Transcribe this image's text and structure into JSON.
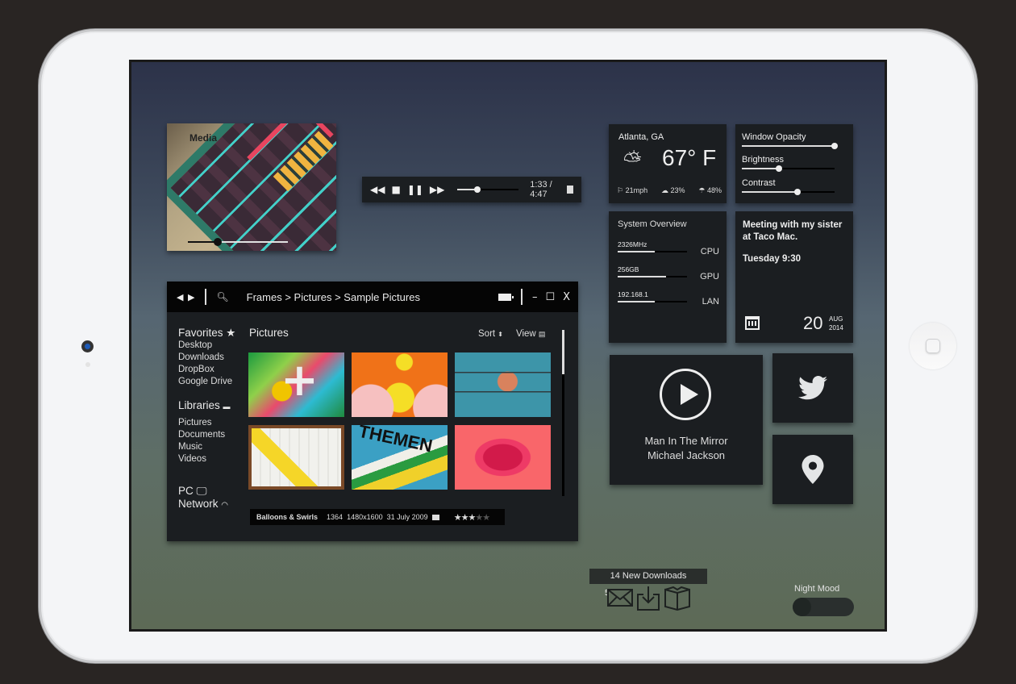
{
  "media": {
    "title": "Media",
    "progress": 0.3
  },
  "player": {
    "rewind_icon": "rewind-icon",
    "stop_icon": "stop-icon",
    "pause_icon": "pause-icon",
    "forward_icon": "fast-forward-icon",
    "time": "1:33 / 4:47",
    "progress": 0.33,
    "volume_icon": "volume-icon"
  },
  "explorer": {
    "breadcrumb": "Frames > Pictures > Sample Pictures",
    "window_controls": {
      "minimize": "–",
      "maximize": "☐",
      "close": "X"
    },
    "sidebar": {
      "favorites": {
        "label": "Favorites",
        "items": [
          "Desktop",
          "Downloads",
          "DropBox",
          "Google Drive"
        ]
      },
      "libraries": {
        "label": "Libraries",
        "items": [
          "Pictures",
          "Documents",
          "Music",
          "Videos"
        ]
      },
      "pc": "PC",
      "network": "Network"
    },
    "content_title": "Pictures",
    "sort_label": "Sort",
    "view_label": "View",
    "thumbnails": [
      "Green abstract",
      "Yellow birds",
      "City map",
      "Poster",
      "Themen print",
      "Pink knot"
    ],
    "selected": {
      "name": "Balloons & Swirls",
      "id": "1364",
      "dimensions": "1480x1600",
      "date": "31 July 2009",
      "rating": 3,
      "rating_max": 5
    }
  },
  "weather": {
    "city": "Atlanta, GA",
    "temperature": "67° F",
    "condition_icon": "partly-cloudy-icon",
    "wind": "21mph",
    "cloud": "23%",
    "rain": "48%"
  },
  "display_settings": [
    {
      "label": "Window Opacity",
      "value": 1.0
    },
    {
      "label": "Brightness",
      "value": 0.4
    },
    {
      "label": "Contrast",
      "value": 0.6
    }
  ],
  "system": {
    "title": "System Overview",
    "rows": [
      {
        "value": "2326MHz",
        "name": "CPU",
        "level": 0.53
      },
      {
        "value": "256GB",
        "name": "GPU",
        "level": 0.7
      },
      {
        "value": "192.168.1",
        "name": "LAN",
        "level": 0.53
      }
    ]
  },
  "event": {
    "title": "Meeting with my sister at Taco Mac.",
    "when": "Tuesday 9:30",
    "day": "20",
    "month": "AUG",
    "year": "2014"
  },
  "music": {
    "song": "Man In The Mirror",
    "artist": "Michael Jackson"
  },
  "downloads": {
    "banner": "14 New Downloads",
    "mail_count": "5"
  },
  "night_mood": {
    "label": "Night Mood",
    "enabled": false
  }
}
